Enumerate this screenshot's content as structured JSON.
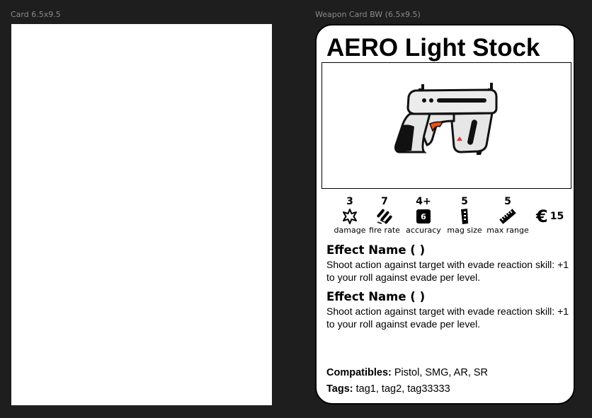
{
  "frames": {
    "left_label": "Card 6.5x9.5",
    "right_label": "Weapon Card BW (6.5x9.5)"
  },
  "card": {
    "title": "AERO Light Stock",
    "image_icon": "pistol-illustration",
    "stats": [
      {
        "value": "3",
        "label": "damage",
        "icon": "burst-icon"
      },
      {
        "value": "7",
        "label": "fire rate",
        "icon": "bullets-icon"
      },
      {
        "value": "4+",
        "label": "accuracy",
        "icon": "d6-icon",
        "die_face": "6"
      },
      {
        "value": "5",
        "label": "mag size",
        "icon": "magazine-icon"
      },
      {
        "value": "5",
        "label": "max range",
        "icon": "ruler-icon"
      }
    ],
    "price": {
      "symbol": "€",
      "value": "15"
    },
    "effects": [
      {
        "name": "Effect Name ( )",
        "text": "Shoot action against target with evade reaction skill: +1 to your roll against evade per level."
      },
      {
        "name": "Effect Name ( )",
        "text": "Shoot action against target with evade reaction skill: +1 to your roll against evade per level."
      }
    ],
    "compatibles": {
      "label": "Compatibles:",
      "value": "Pistol, SMG, AR, SR"
    },
    "tags": {
      "label": "Tags:",
      "value": "tag1, tag2, tag33333"
    }
  }
}
